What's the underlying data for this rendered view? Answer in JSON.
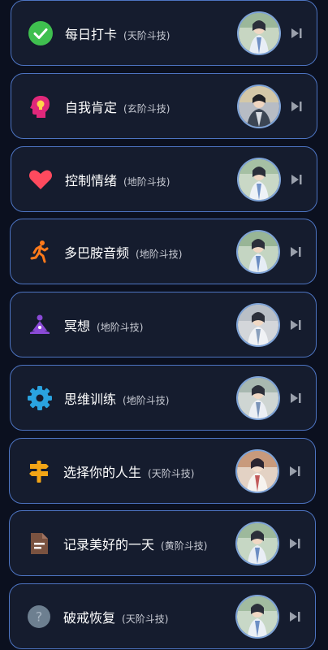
{
  "items": [
    {
      "title": "每日打卡",
      "level": "(天阶斗技)",
      "icon": "check-circle-icon"
    },
    {
      "title": "自我肯定",
      "level": "(玄阶斗技)",
      "icon": "head-lightbulb-icon"
    },
    {
      "title": "控制情绪",
      "level": "(地阶斗技)",
      "icon": "heart-icon"
    },
    {
      "title": "多巴胺音频",
      "level": "(地阶斗技)",
      "icon": "running-person-icon"
    },
    {
      "title": "冥想",
      "level": "(地阶斗技)",
      "icon": "meditation-icon"
    },
    {
      "title": "思维训练",
      "level": "(地阶斗技)",
      "icon": "gear-icon"
    },
    {
      "title": "选择你的人生",
      "level": "(天阶斗技)",
      "icon": "crossroads-sign-icon"
    },
    {
      "title": "记录美好的一天",
      "level": "(黄阶斗技)",
      "icon": "document-icon"
    },
    {
      "title": "破戒恢复",
      "level": "(天阶斗技)",
      "icon": "question-circle-icon"
    }
  ],
  "colors": {
    "card_border": "#4d74c2",
    "card_bg": "#151c2e",
    "page_bg": "#0b101f"
  }
}
